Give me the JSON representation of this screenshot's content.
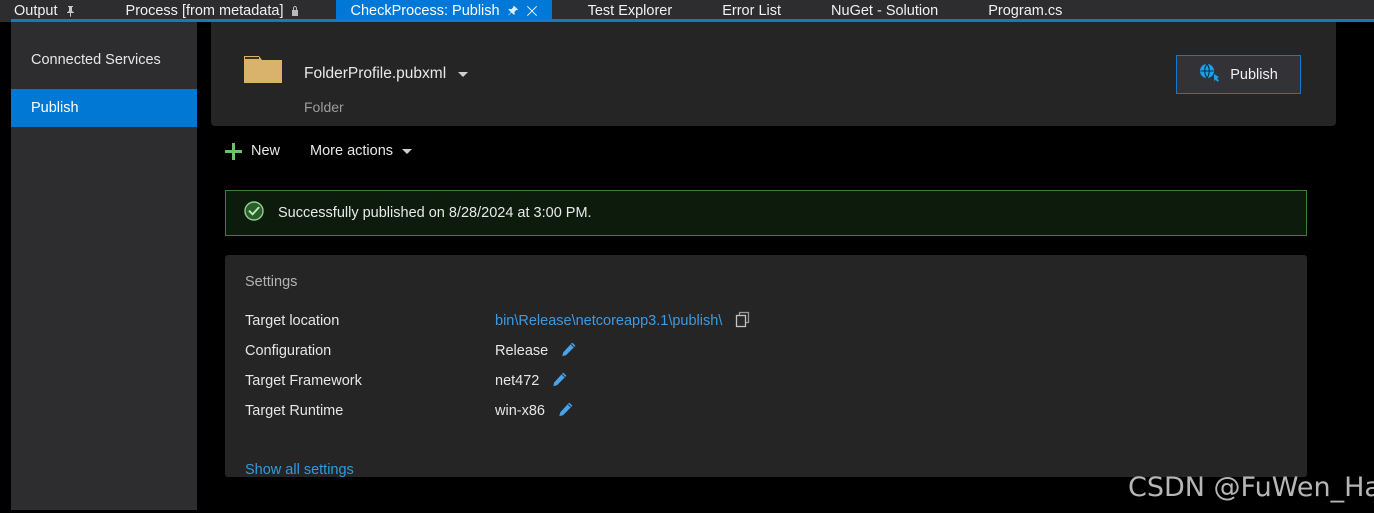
{
  "tabs": [
    {
      "label": "Output",
      "icon": "pin-icon",
      "active": false
    },
    {
      "label": "Process [from metadata]",
      "icon": "lock-icon",
      "active": false
    },
    {
      "label": "CheckProcess: Publish",
      "icon": "pin-icon",
      "icon2": "close-icon",
      "active": true
    },
    {
      "label": "Test Explorer",
      "icon": "",
      "active": false
    },
    {
      "label": "Error List",
      "icon": "",
      "active": false
    },
    {
      "label": "NuGet - Solution",
      "icon": "",
      "active": false
    },
    {
      "label": "Program.cs",
      "icon": "",
      "active": false
    }
  ],
  "sidebar": {
    "items": [
      {
        "label": "Connected Services",
        "selected": false
      },
      {
        "label": "Publish",
        "selected": true
      }
    ]
  },
  "profile": {
    "icon": "folder-icon",
    "name": "FolderProfile.pubxml",
    "subtitle": "Folder",
    "publish_button": {
      "label": "Publish",
      "icon": "web-publish-globe-icon"
    }
  },
  "toolbar": {
    "new_label": "New",
    "more_actions_label": "More actions"
  },
  "banner": {
    "icon": "success-check-icon",
    "message": "Successfully published on 8/28/2024 at 3:00 PM."
  },
  "settings": {
    "title": "Settings",
    "rows": [
      {
        "label": "Target location",
        "value": "bin\\Release\\netcoreapp3.1\\publish\\",
        "value_type": "link",
        "action_icon": "copy-icon"
      },
      {
        "label": "Configuration",
        "value": "Release",
        "value_type": "text",
        "action_icon": "pencil-edit-icon"
      },
      {
        "label": "Target Framework",
        "value": "net472",
        "value_type": "text",
        "action_icon": "pencil-edit-icon"
      },
      {
        "label": "Target Runtime",
        "value": "win-x86",
        "value_type": "text",
        "action_icon": "pencil-edit-icon"
      }
    ],
    "show_all_label": "Show all settings"
  },
  "watermark": "CSDN @FuWen_Hao",
  "colors": {
    "accent_blue": "#0078d7",
    "link_blue": "#3d9ae0",
    "success_green": "#3f7a3f",
    "plus_green": "#6cc26c",
    "folder_tan": "#d9b36c",
    "panel_bg": "#252526",
    "sidebar_bg": "#2d2d30"
  }
}
